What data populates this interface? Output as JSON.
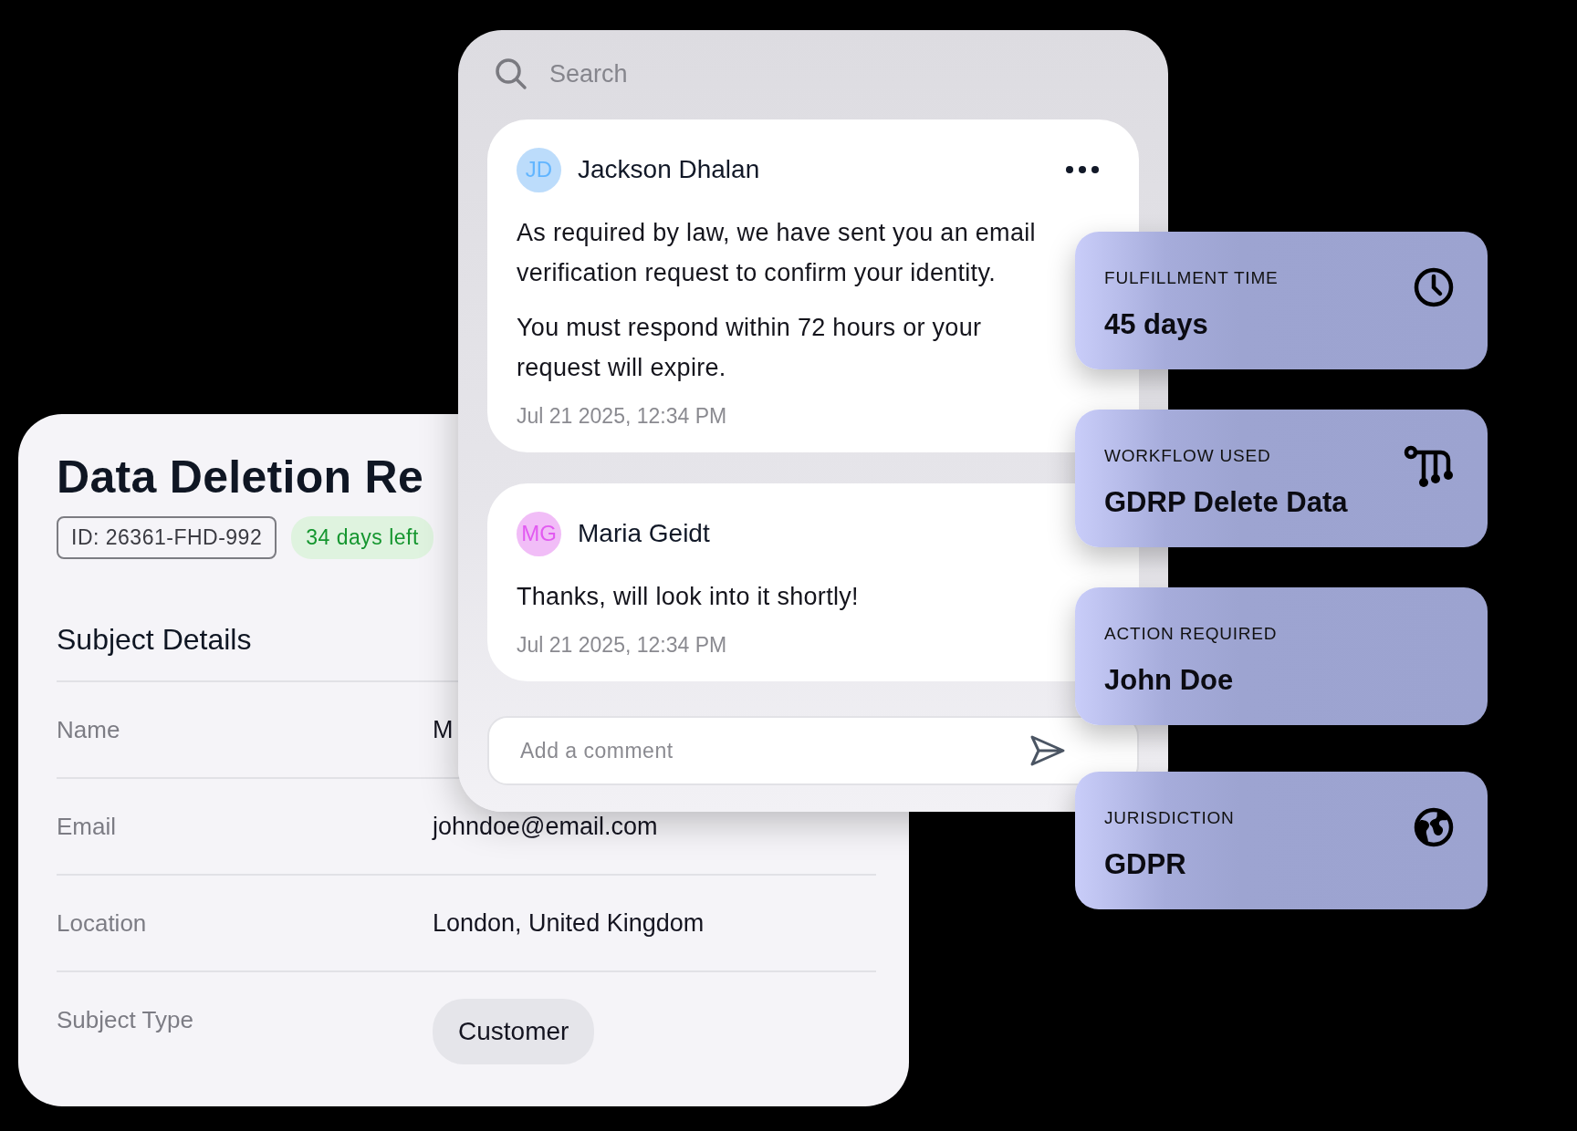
{
  "search": {
    "placeholder": "Search"
  },
  "messages": [
    {
      "initials": "JD",
      "color": "#bcdcfb",
      "author": "Jackson Dhalan",
      "has_menu": true,
      "paragraphs": [
        "As required by law, we have sent you an email verification request to confirm your identity.",
        "You must respond within 72 hours or your request will expire."
      ],
      "time": "Jul 21 2025, 12:34 PM"
    },
    {
      "initials": "MG",
      "color": "#f1bdf7",
      "author": "Maria Geidt",
      "has_menu": false,
      "paragraphs": [
        "Thanks, will look into it shortly!"
      ],
      "time": "Jul 21 2025, 12:34 PM"
    }
  ],
  "comment": {
    "placeholder": "Add a comment"
  },
  "request": {
    "title": "Data Deletion Re",
    "id": "ID: 26361-FHD-992",
    "deadline": "34 days left",
    "section": "Subject Details",
    "fields": [
      {
        "label": "Name",
        "value": "M",
        "kind": "text"
      },
      {
        "label": "Email",
        "value": "johndoe@email.com",
        "kind": "text"
      },
      {
        "label": "Location",
        "value": "London, United Kingdom",
        "kind": "text"
      },
      {
        "label": "Subject Type",
        "value": "Customer",
        "kind": "tag"
      }
    ]
  },
  "facts": [
    {
      "label": "FULFILLMENT TIME",
      "value": "45 days",
      "kind": "clock"
    },
    {
      "label": "WORKFLOW USED",
      "value": "GDRP Delete Data",
      "kind": "workflow"
    },
    {
      "label": "ACTION REQUIRED",
      "value": "John Doe",
      "kind": "plain"
    },
    {
      "label": "JURISDICTION",
      "value": "GDPR",
      "kind": "globe"
    }
  ]
}
